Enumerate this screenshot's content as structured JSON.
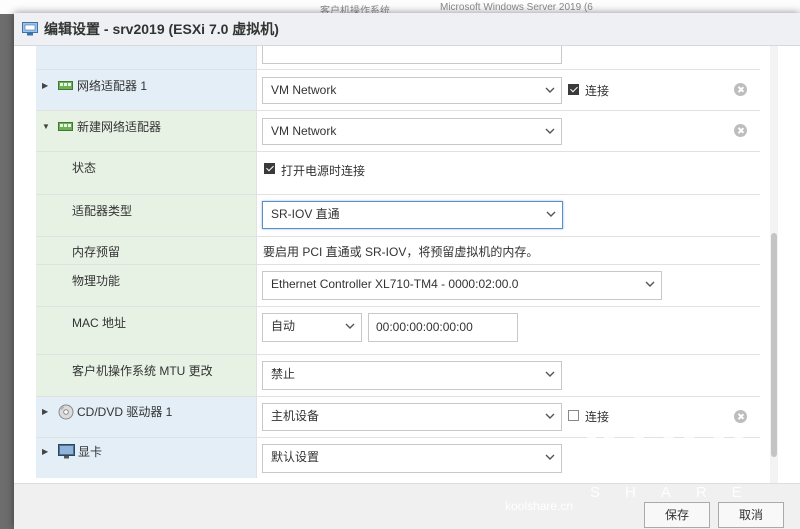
{
  "background": {
    "tab1": "客户机操作系统",
    "tab2": "Microsoft Windows Server 2019 (6"
  },
  "dialog": {
    "title": "编辑设置 - srv2019 (ESXi 7.0 虚拟机)"
  },
  "rows": {
    "nic1": {
      "label": "网络适配器 1",
      "network": "VM Network",
      "connect_label": "连接",
      "connected": true
    },
    "newnic": {
      "label": "新建网络适配器",
      "network": "VM Network"
    },
    "status": {
      "label": "状态",
      "option_label": "打开电源时连接",
      "checked": true
    },
    "adapter_type": {
      "label": "适配器类型",
      "value": "SR-IOV 直通"
    },
    "memory": {
      "label": "内存预留",
      "text": "要启用 PCI 直通或 SR-IOV，将预留虚拟机的内存。"
    },
    "physical": {
      "label": "物理功能",
      "value": "Ethernet Controller XL710-TM4 - 0000:02:00.0"
    },
    "mac": {
      "label": "MAC 地址",
      "mode": "自动",
      "address": "00:00:00:00:00:00"
    },
    "mtu": {
      "label": "客户机操作系统 MTU 更改",
      "value": "禁止"
    },
    "cddvd": {
      "label": "CD/DVD 驱动器 1",
      "value": "主机设备",
      "connect_label": "连接",
      "connected": false
    },
    "video": {
      "label": "显卡",
      "value": "默认设置"
    }
  },
  "footer": {
    "save": "保存",
    "cancel": "取消"
  },
  "watermark": {
    "logo": "KOOL",
    "share": "SHARE",
    "url": "koolshare.cn"
  },
  "scrollbar": {
    "position_fraction": 0.45
  }
}
